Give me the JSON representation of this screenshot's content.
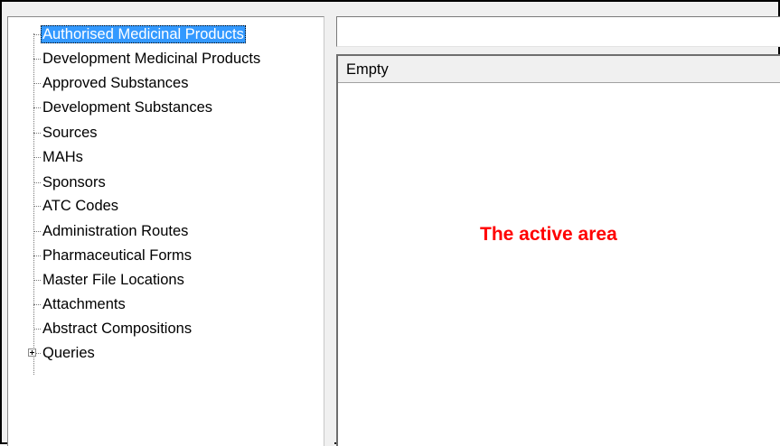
{
  "tree": {
    "items": [
      {
        "label": "Authorised Medicinal Products",
        "selected": true
      },
      {
        "label": "Development Medicinal Products"
      },
      {
        "label": "Approved Substances"
      },
      {
        "label": "Development Substances"
      },
      {
        "label": "Sources"
      },
      {
        "label": "MAHs"
      },
      {
        "label": "Sponsors"
      },
      {
        "label": "ATC Codes"
      },
      {
        "label": "Administration Routes"
      },
      {
        "label": "Pharmaceutical Forms"
      },
      {
        "label": "Master File Locations"
      },
      {
        "label": "Attachments"
      },
      {
        "label": "Abstract Compositions"
      },
      {
        "label": "Queries",
        "expandable": true,
        "expander_icon": "plus-expander-icon"
      }
    ],
    "selection_color": "#3399ff"
  },
  "top_field": {
    "value": ""
  },
  "grid": {
    "header_label": "Empty"
  },
  "annotation": {
    "text": "The active area",
    "color": "#ff0000"
  }
}
